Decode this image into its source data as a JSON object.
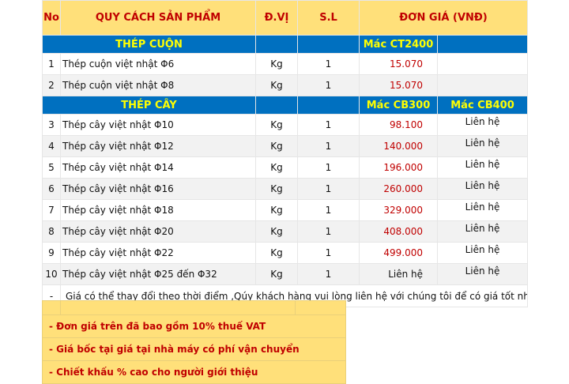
{
  "header": {
    "no": "No",
    "product": "QUY CÁCH SẢN PHẨM",
    "unit": "Đ.VỊ",
    "qty": "S.L",
    "price": "ĐƠN GIÁ (VNĐ)"
  },
  "groups": {
    "coil": {
      "title": "THÉP CUỘN",
      "grade1": "Mác CT2400"
    },
    "bar": {
      "title": "THÉP CÂY",
      "grade1": "Mác CB300",
      "grade2": "Mác CB400"
    }
  },
  "rows": [
    {
      "no": "1",
      "name": "Thép cuộn việt nhật  Φ6",
      "unit": "Kg",
      "qty": "1",
      "price1": "15.070",
      "price2": ""
    },
    {
      "no": "2",
      "name": "Thép cuộn việt nhật  Φ8",
      "unit": "Kg",
      "qty": "1",
      "price1": "15.070",
      "price2": ""
    },
    {
      "no": "3",
      "name": "Thép cây việt nhật Φ10",
      "unit": "Kg",
      "qty": "1",
      "price1": "98.100",
      "price2": "Liên hệ"
    },
    {
      "no": "4",
      "name": "Thép cây việt nhật Φ12",
      "unit": "Kg",
      "qty": "1",
      "price1": "140.000",
      "price2": "Liên hệ"
    },
    {
      "no": "5",
      "name": "Thép cây việt nhật Φ14",
      "unit": "Kg",
      "qty": "1",
      "price1": "196.000",
      "price2": "Liên hệ"
    },
    {
      "no": "6",
      "name": "Thép cây việt nhật Φ16",
      "unit": "Kg",
      "qty": "1",
      "price1": "260.000",
      "price2": "Liên hệ"
    },
    {
      "no": "7",
      "name": "Thép cây việt nhật Φ18",
      "unit": "Kg",
      "qty": "1",
      "price1": "329.000",
      "price2": "Liên hệ"
    },
    {
      "no": "8",
      "name": "Thép cây việt nhật Φ20",
      "unit": "Kg",
      "qty": "1",
      "price1": "408.000",
      "price2": "Liên hệ"
    },
    {
      "no": "9",
      "name": "Thép cây việt nhật Φ22",
      "unit": "Kg",
      "qty": "1",
      "price1": "499.000",
      "price2": "Liên hệ"
    },
    {
      "no": "10",
      "name": "Thép cây việt nhật Φ25 đến Φ32",
      "unit": "Kg",
      "qty": "1",
      "price1": "Liên hệ",
      "price2": "Liên hệ"
    }
  ],
  "note": {
    "dash": "-",
    "text": "Giá có thể thay đổi theo thời điểm ,Qúy khách hàng vui lòng liên hệ với chúng tôi để có giá tốt nhất."
  },
  "footer": [
    "-  Đơn giá trên đã bao gồm 10% thuế VAT",
    "-  Giá bốc tại giá tại nhà máy có phí vận chuyển",
    "-  Chiết khấu % cao cho người giới thiệu"
  ],
  "colors": {
    "header_bg": "#ffe07a",
    "band_bg": "#0070c0",
    "band_text": "#ffff00",
    "accent_red": "#c00000"
  }
}
